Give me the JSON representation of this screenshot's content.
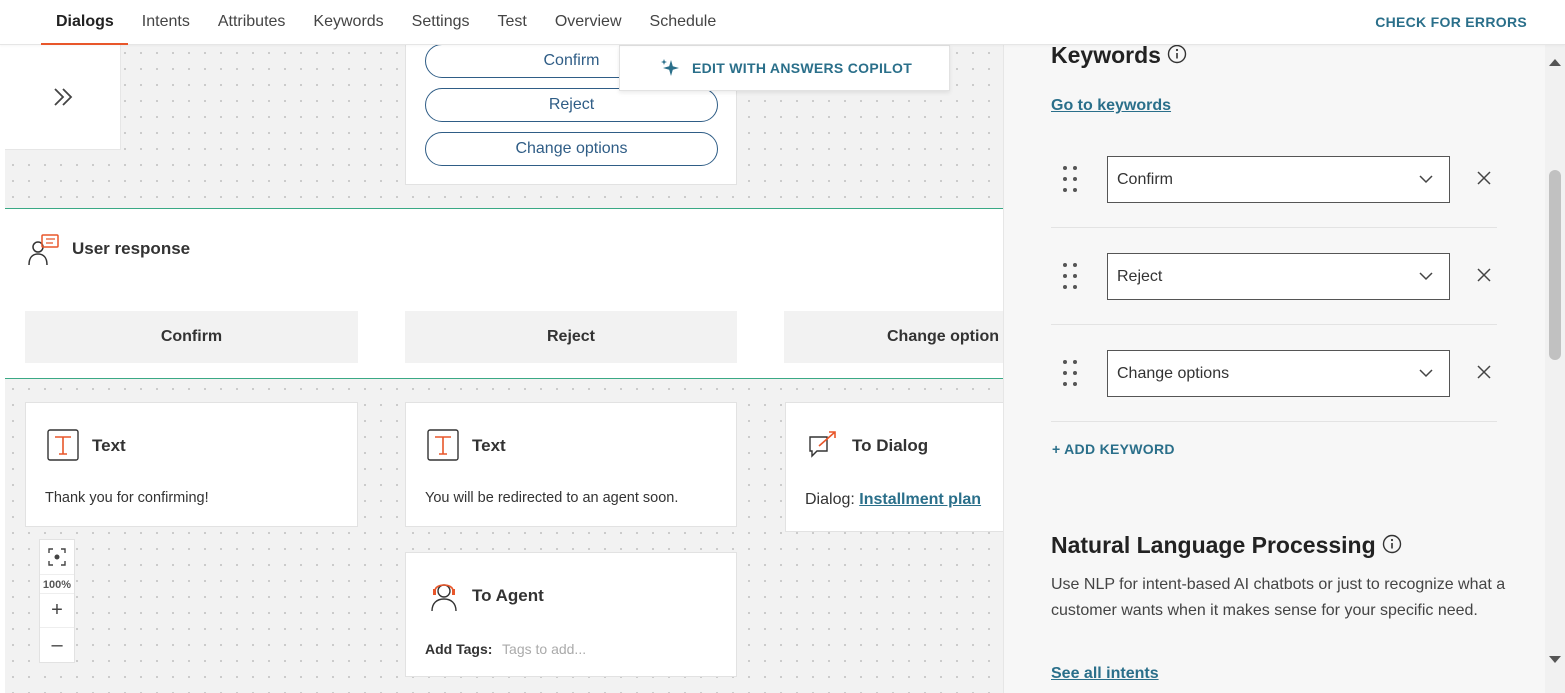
{
  "nav": {
    "tabs": [
      {
        "label": "Dialogs"
      },
      {
        "label": "Intents"
      },
      {
        "label": "Attributes"
      },
      {
        "label": "Keywords"
      },
      {
        "label": "Settings"
      },
      {
        "label": "Test"
      },
      {
        "label": "Overview"
      },
      {
        "label": "Schedule"
      }
    ],
    "active_tab": "Dialogs",
    "check_errors": "CHECK FOR ERRORS"
  },
  "canvas": {
    "option_buttons": [
      "Confirm",
      "Reject",
      "Change options"
    ],
    "copilot_label": "EDIT WITH ANSWERS COPILOT",
    "user_response": {
      "title": "User response",
      "buttons": [
        "Confirm",
        "Reject",
        "Change option"
      ]
    },
    "nodes": {
      "text1": {
        "title": "Text",
        "body": "Thank you for confirming!"
      },
      "text2": {
        "title": "Text",
        "body": "You will be redirected to an agent soon."
      },
      "to_dialog": {
        "title": "To Dialog",
        "prefix": "Dialog:",
        "link": "Installment plan"
      },
      "to_agent": {
        "title": "To Agent",
        "tags_label": "Add Tags:",
        "tags_placeholder": "Tags to add..."
      }
    },
    "zoom": {
      "level": "100%",
      "plus": "+",
      "minus": "–"
    }
  },
  "panel": {
    "keywords_title": "Keywords",
    "goto_keywords": "Go to keywords",
    "keywords": [
      "Confirm",
      "Reject",
      "Change options"
    ],
    "add_keyword": "+ ADD KEYWORD",
    "nlp_title": "Natural Language Processing",
    "nlp_description": "Use NLP for intent-based AI chatbots or just to recognize what a customer wants when it makes sense for your specific need.",
    "see_all_intents": "See all intents"
  },
  "colors": {
    "accent_orange": "#e8562a",
    "link_teal": "#2a6f8a",
    "pill_blue": "#2f5d86",
    "divider_green": "#3aa985"
  }
}
